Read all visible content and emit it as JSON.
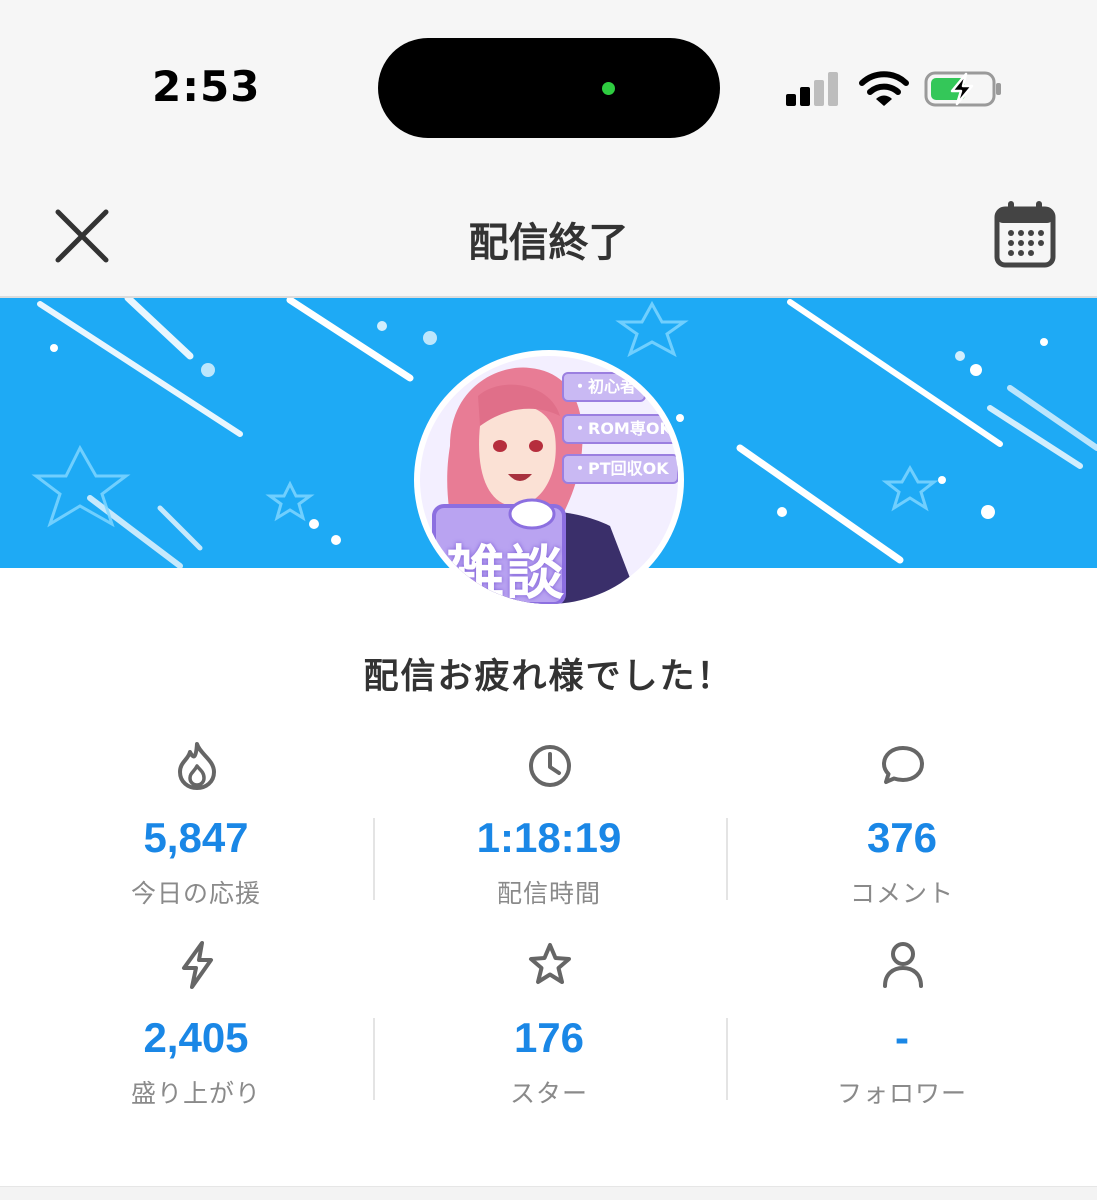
{
  "status_bar": {
    "time": "2:53"
  },
  "header": {
    "title": "配信終了"
  },
  "avatar": {
    "tags": [
      "・初心者",
      "・ROM専OK",
      "・PT回収OK"
    ],
    "badge_text": "雑談"
  },
  "main": {
    "thanks_message": "配信お疲れ様でした！",
    "stats": [
      {
        "icon": "flame-icon",
        "value": "5,847",
        "label": "今日の応援"
      },
      {
        "icon": "clock-icon",
        "value": "1:18:19",
        "label": "配信時間"
      },
      {
        "icon": "comment-icon",
        "value": "376",
        "label": "コメント"
      },
      {
        "icon": "lightning-icon",
        "value": "2,405",
        "label": "盛り上がり"
      },
      {
        "icon": "star-icon",
        "value": "176",
        "label": "スター"
      },
      {
        "icon": "person-icon",
        "value": "-",
        "label": "フォロワー"
      }
    ]
  },
  "colors": {
    "accent": "#1a87e6",
    "banner": "#1eaaf5",
    "icon": "#666666",
    "label": "#8a8a8a"
  }
}
